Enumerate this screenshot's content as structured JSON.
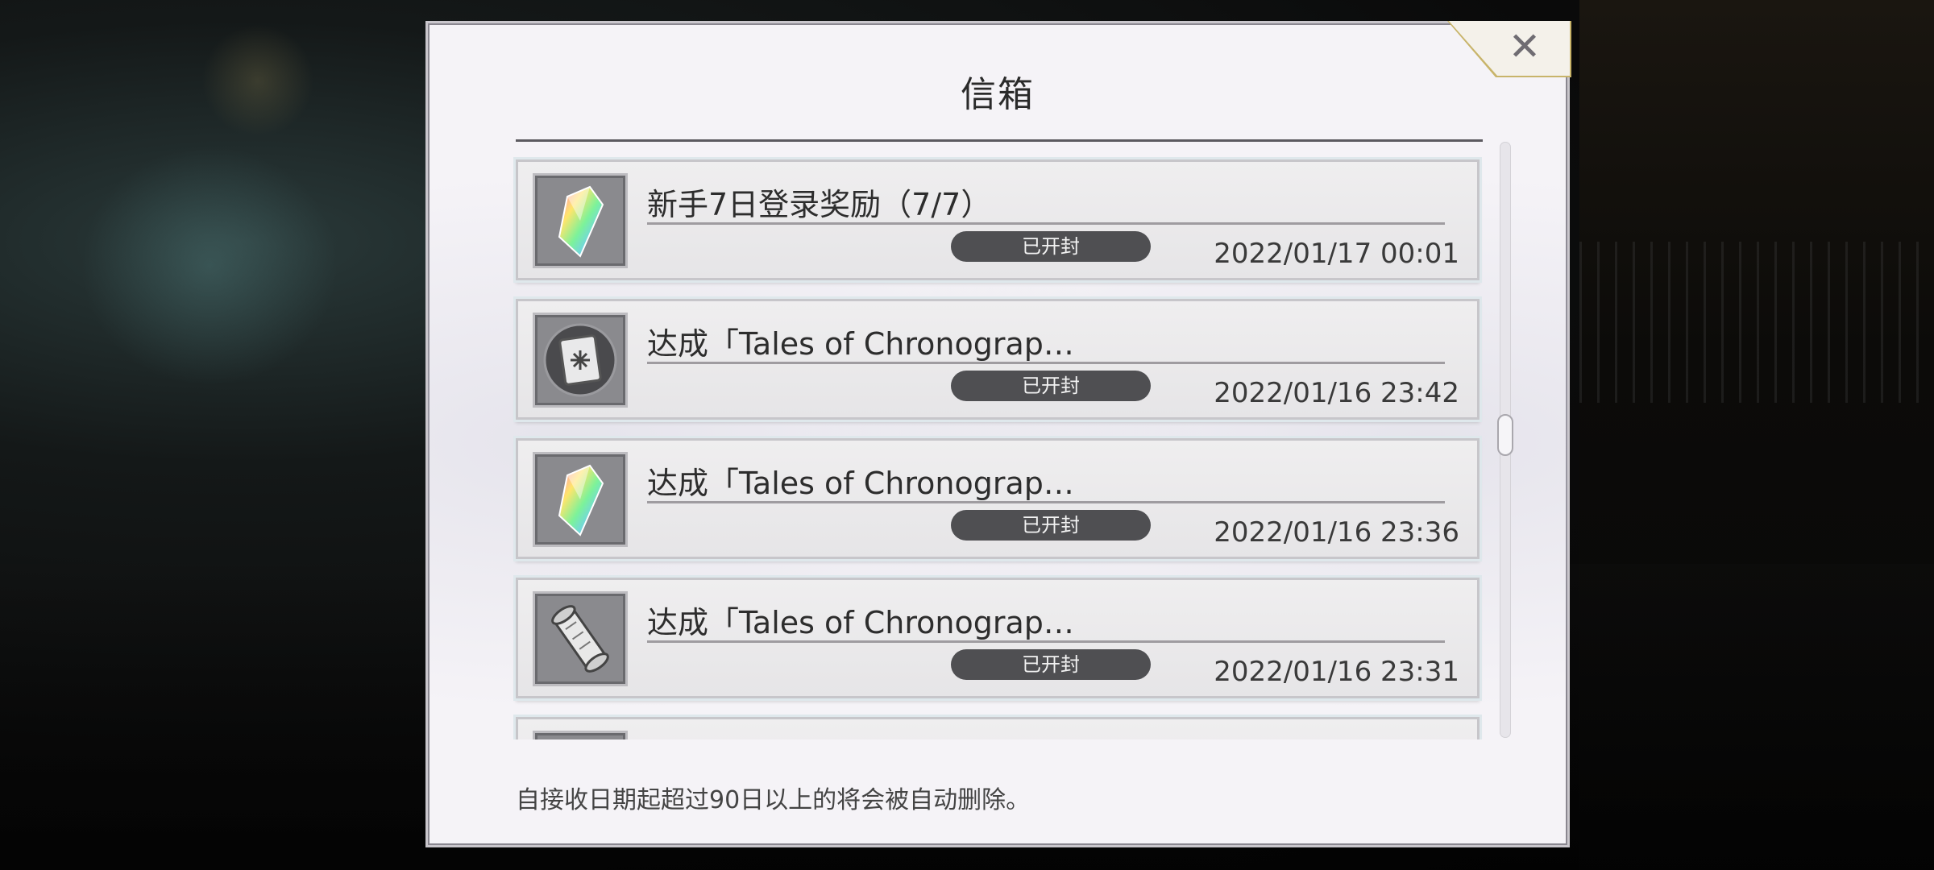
{
  "dialog": {
    "title": "信箱",
    "close_icon": "close-icon",
    "footer_note": "自接收日期起超过90日以上的将会被自动删除。"
  },
  "mails": [
    {
      "icon": "rainbow-crystal-icon",
      "title": "新手7日登录奖励（7/7）",
      "status": "已开封",
      "date": "2022/01/17 00:01"
    },
    {
      "icon": "book-icon",
      "title": "达成「Tales of Chronograp…",
      "status": "已开封",
      "date": "2022/01/16 23:42"
    },
    {
      "icon": "rainbow-crystal-icon",
      "title": "达成「Tales of Chronograp…",
      "status": "已开封",
      "date": "2022/01/16 23:36"
    },
    {
      "icon": "scroll-icon",
      "title": "达成「Tales of Chronograp…",
      "status": "已开封",
      "date": "2022/01/16 23:31"
    }
  ],
  "colors": {
    "dialog_bg": "#f5f3f7",
    "badge_bg": "#4f4f52",
    "close_border": "#c8b46a"
  }
}
